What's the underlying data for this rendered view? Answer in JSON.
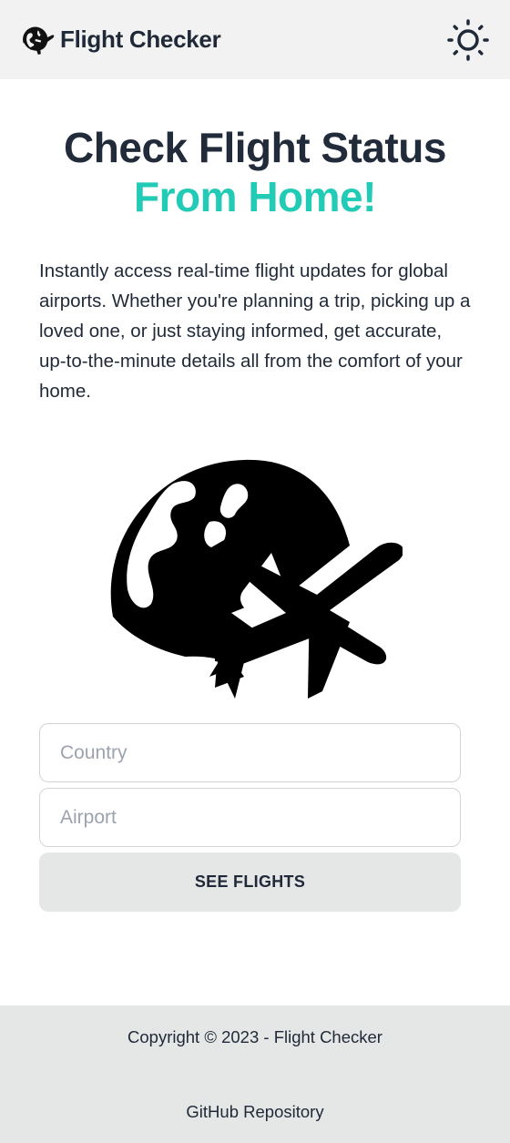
{
  "navbar": {
    "brand_name": "Flight Checker",
    "logo_icon": "globe-plane-icon",
    "theme_toggle_icon": "sun-icon"
  },
  "hero": {
    "title_line1": "Check Flight Status",
    "title_line2": "From Home!",
    "description": "Instantly access real-time flight updates for global airports. Whether you're planning a trip, picking up a loved one, or just staying informed, get accurate, up-to-the-minute details all from the comfort of your home.",
    "illustration_icon": "globe-plane-icon"
  },
  "form": {
    "country_placeholder": "Country",
    "country_value": "",
    "airport_placeholder": "Airport",
    "airport_value": "",
    "submit_label": "SEE FLIGHTS"
  },
  "footer": {
    "copyright": "Copyright © 2023 - Flight Checker",
    "repo_link": "GitHub Repository"
  },
  "colors": {
    "accent": "#22cbb6",
    "heading": "#222b3a",
    "navbar_bg": "#f2f2f2",
    "footer_bg": "#e5e6e6"
  }
}
